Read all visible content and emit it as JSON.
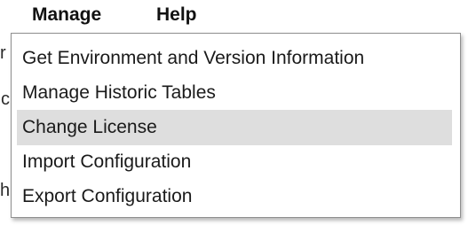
{
  "menubar": {
    "items": [
      {
        "label": "Manage",
        "open": true
      },
      {
        "label": "Help",
        "open": false
      }
    ]
  },
  "background_fragments": [
    "r",
    "c",
    "h"
  ],
  "manage_menu": {
    "highlighted_index": 2,
    "items": [
      {
        "label": "Get Environment and Version Information"
      },
      {
        "label": "Manage Historic Tables"
      },
      {
        "label": "Change License"
      },
      {
        "label": "Import Configuration"
      },
      {
        "label": "Export Configuration"
      }
    ]
  }
}
